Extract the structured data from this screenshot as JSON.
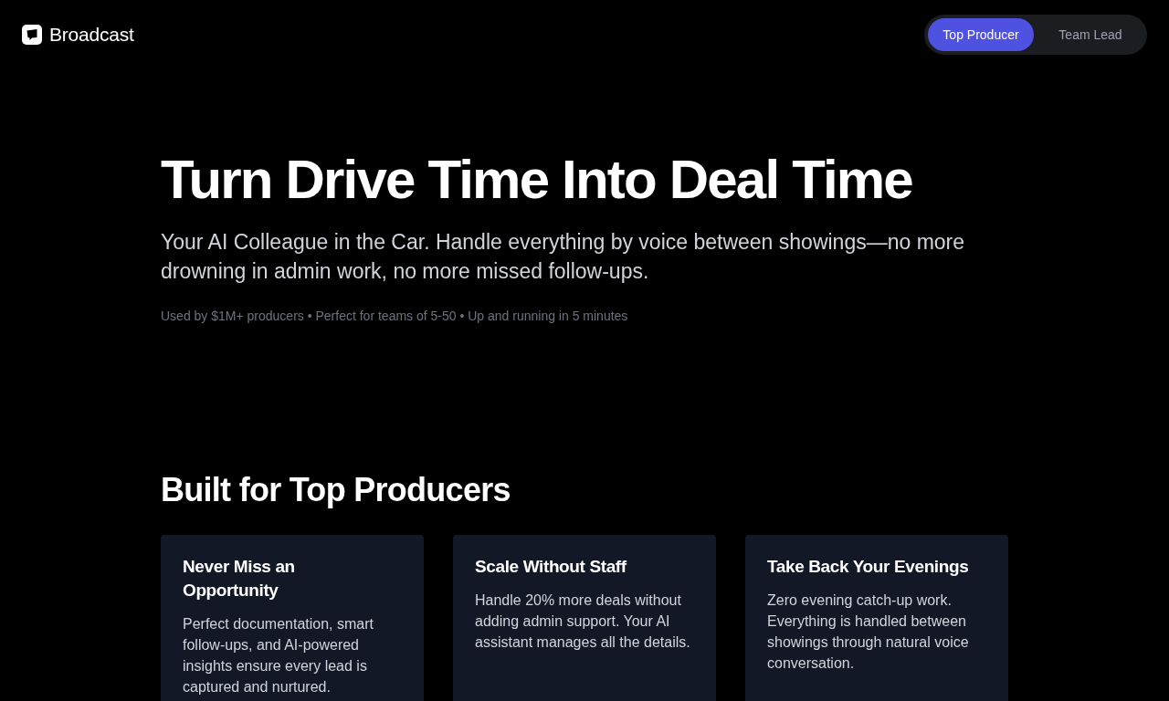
{
  "header": {
    "logo_text": "Broadcast",
    "mode_toggle": [
      {
        "label": "Top Producer",
        "selected": true
      },
      {
        "label": "Team Lead",
        "selected": false
      }
    ]
  },
  "hero": {
    "title": "Turn Drive Time Into Deal Time",
    "subtitle": "Your AI Colleague in the Car. Handle everything by voice between showings—no more drowning in admin work, no more missed follow-ups.",
    "meta": "Used by $1M+ producers • Perfect for teams of 5-50 • Up and running in 5 minutes"
  },
  "features": {
    "heading": "Built for Top Producers",
    "cards": [
      {
        "title": "Never Miss an Opportunity",
        "description": "Perfect documentation, smart follow-ups, and AI-powered insights ensure every lead is captured and nurtured."
      },
      {
        "title": "Scale Without Staff",
        "description": "Handle 20% more deals without adding admin support. Your AI assistant manages all the details."
      },
      {
        "title": "Take Back Your Evenings",
        "description": "Zero evening catch-up work. Everything is handled between showings through natural voice conversation."
      }
    ]
  }
}
